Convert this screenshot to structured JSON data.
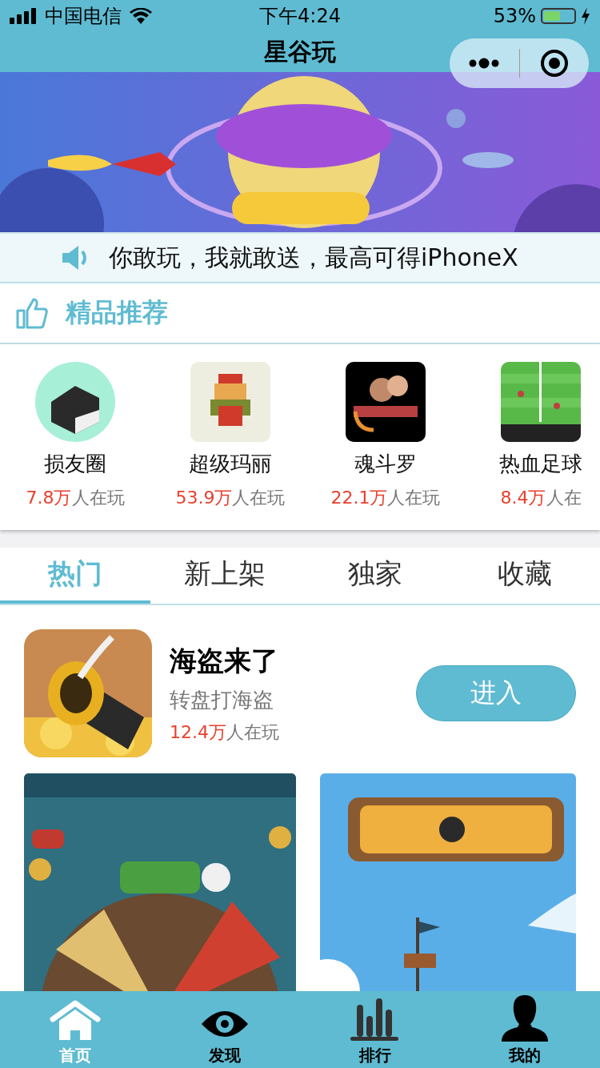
{
  "status_bar": {
    "carrier": "中国电信",
    "time": "下午4:24",
    "battery_percent": "53%",
    "battery": {
      "level": 0.55
    }
  },
  "nav": {
    "title": "星谷玩"
  },
  "notice": {
    "text": "你敢玩，我就敢送，最高可得iPhoneX"
  },
  "section": {
    "title": "精品推荐"
  },
  "games": [
    {
      "name": "损友圈",
      "count": "7.8万",
      "label": "人在玩"
    },
    {
      "name": "超级玛丽",
      "count": "53.9万",
      "label": "人在玩"
    },
    {
      "name": "魂斗罗",
      "count": "22.1万",
      "label": "人在玩"
    },
    {
      "name": "热血足球",
      "count": "8.4万",
      "label": "人在"
    }
  ],
  "tabs": [
    {
      "label": "热门",
      "selected": true
    },
    {
      "label": "新上架",
      "selected": false
    },
    {
      "label": "独家",
      "selected": false
    },
    {
      "label": "收藏",
      "selected": false
    }
  ],
  "featured": {
    "title": "海盗来了",
    "subtitle": "转盘打海盗",
    "count": "12.4万",
    "label": "人在玩",
    "button": "进入"
  },
  "tabbar": [
    {
      "label": "首页",
      "kind": "home",
      "selected": true
    },
    {
      "label": "发现",
      "kind": "eye",
      "selected": false
    },
    {
      "label": "排行",
      "kind": "chart",
      "selected": false
    },
    {
      "label": "我的",
      "kind": "person",
      "selected": false
    }
  ]
}
